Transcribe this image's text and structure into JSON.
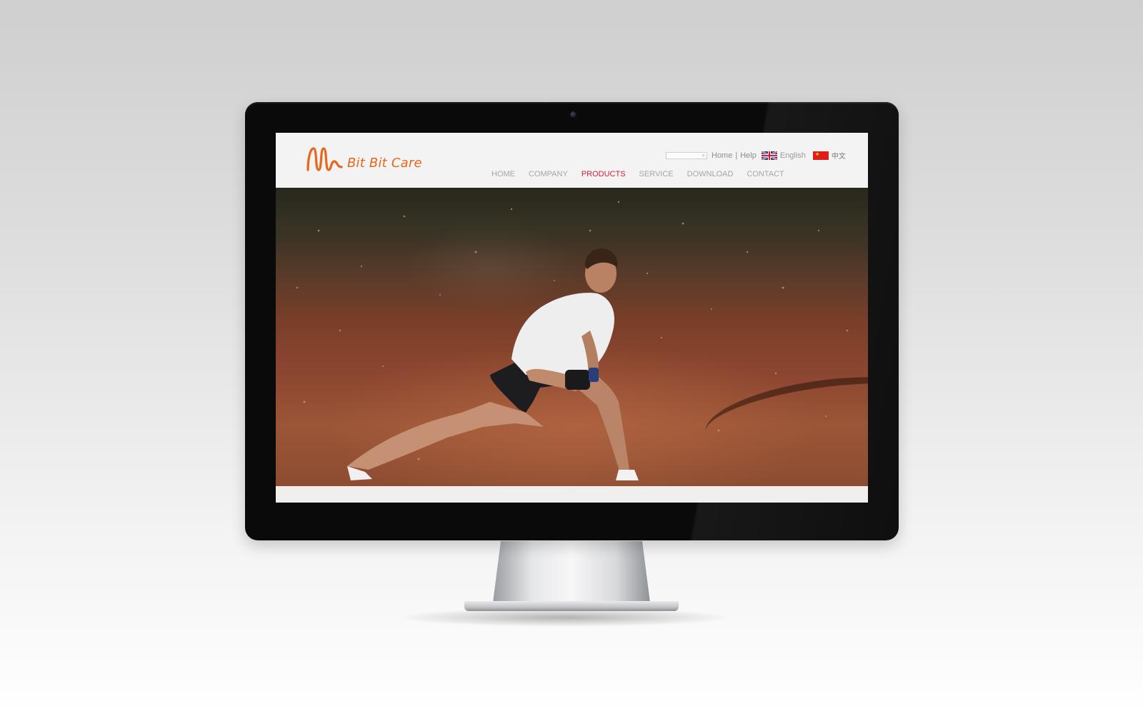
{
  "brand": {
    "name": "Bit Bit Care",
    "color": "#e8661b"
  },
  "utility": {
    "search_placeholder": "",
    "home_label": "Home",
    "separator": "|",
    "help_label": "Help",
    "lang_english": "English",
    "lang_chinese": "中文"
  },
  "nav": {
    "items": [
      {
        "label": "HOME"
      },
      {
        "label": "COMPANY"
      },
      {
        "label": "PRODUCTS"
      },
      {
        "label": "SERVICE"
      },
      {
        "label": "DOWNLOAD"
      },
      {
        "label": "CONTACT"
      }
    ],
    "active": "PRODUCTS",
    "active_color": "#d8203a"
  },
  "hero": {
    "icons": [
      "uk-flag-icon",
      "china-flag-icon",
      "search-icon"
    ]
  }
}
